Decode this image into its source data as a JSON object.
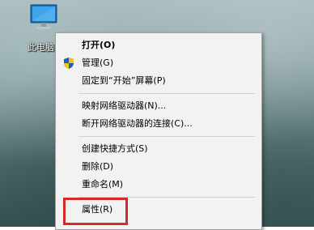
{
  "desktop": {
    "icon_label": "此电脑",
    "icon_name": "computer-icon"
  },
  "context_menu": {
    "items": [
      {
        "label": "打开(O)",
        "bold": true
      },
      {
        "label": "管理(G)",
        "icon": "shield-icon"
      },
      {
        "label": "固定到“开始”屏幕(P)"
      },
      {
        "label": "映射网络驱动器(N)..."
      },
      {
        "label": "断开网络驱动器的连接(C)..."
      },
      {
        "label": "创建快捷方式(S)"
      },
      {
        "label": "删除(D)"
      },
      {
        "label": "重命名(M)"
      },
      {
        "label": "属性(R)"
      }
    ]
  },
  "annotation": {
    "highlight_color": "#d42a2a"
  }
}
